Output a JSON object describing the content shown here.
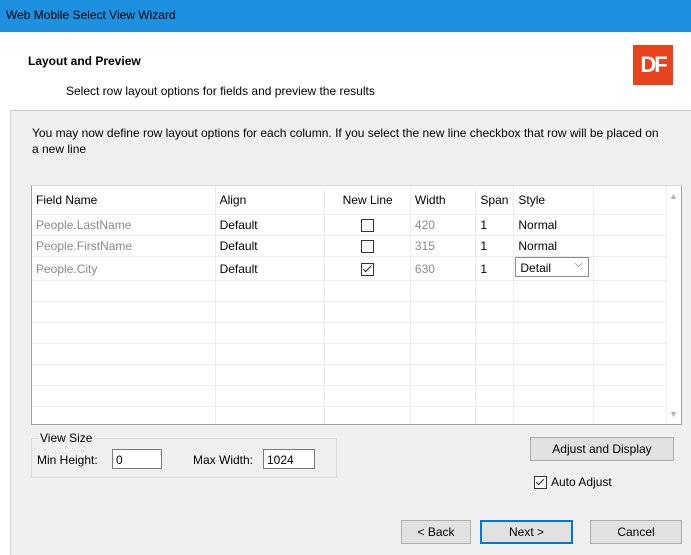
{
  "window": {
    "title": "Web Mobile Select View Wizard"
  },
  "header": {
    "title": "Layout and  Preview",
    "subtitle": "Select row layout options for fields and preview the results",
    "logo_text": "DF",
    "logo_color": "#e8431c"
  },
  "intro": "You may now define row layout options for each column. If you select the new line checkbox that row will be placed on a new line",
  "grid": {
    "columns": [
      "Field Name",
      "Align",
      "New Line",
      "Width",
      "Span",
      "Style"
    ],
    "rows": [
      {
        "field": "People.LastName",
        "align": "Default",
        "new_line": false,
        "width": "420",
        "span": "1",
        "style": "Normal"
      },
      {
        "field": "People.FirstName",
        "align": "Default",
        "new_line": false,
        "width": "315",
        "span": "1",
        "style": "Normal"
      },
      {
        "field": "People.City",
        "align": "Default",
        "new_line": true,
        "width": "630",
        "span": "1",
        "style": "Detail"
      }
    ]
  },
  "view_size": {
    "legend": "View Size",
    "min_height_label": "Min Height:",
    "min_height_value": "0",
    "max_width_label": "Max Width:",
    "max_width_value": "1024"
  },
  "buttons": {
    "adjust": "Adjust and Display",
    "back": "< Back",
    "next": "Next >",
    "cancel": "Cancel"
  },
  "auto_adjust": {
    "label": "Auto Adjust",
    "checked": true
  },
  "colors": {
    "titlebar": "#1e90e0",
    "accent": "#0078d7"
  }
}
